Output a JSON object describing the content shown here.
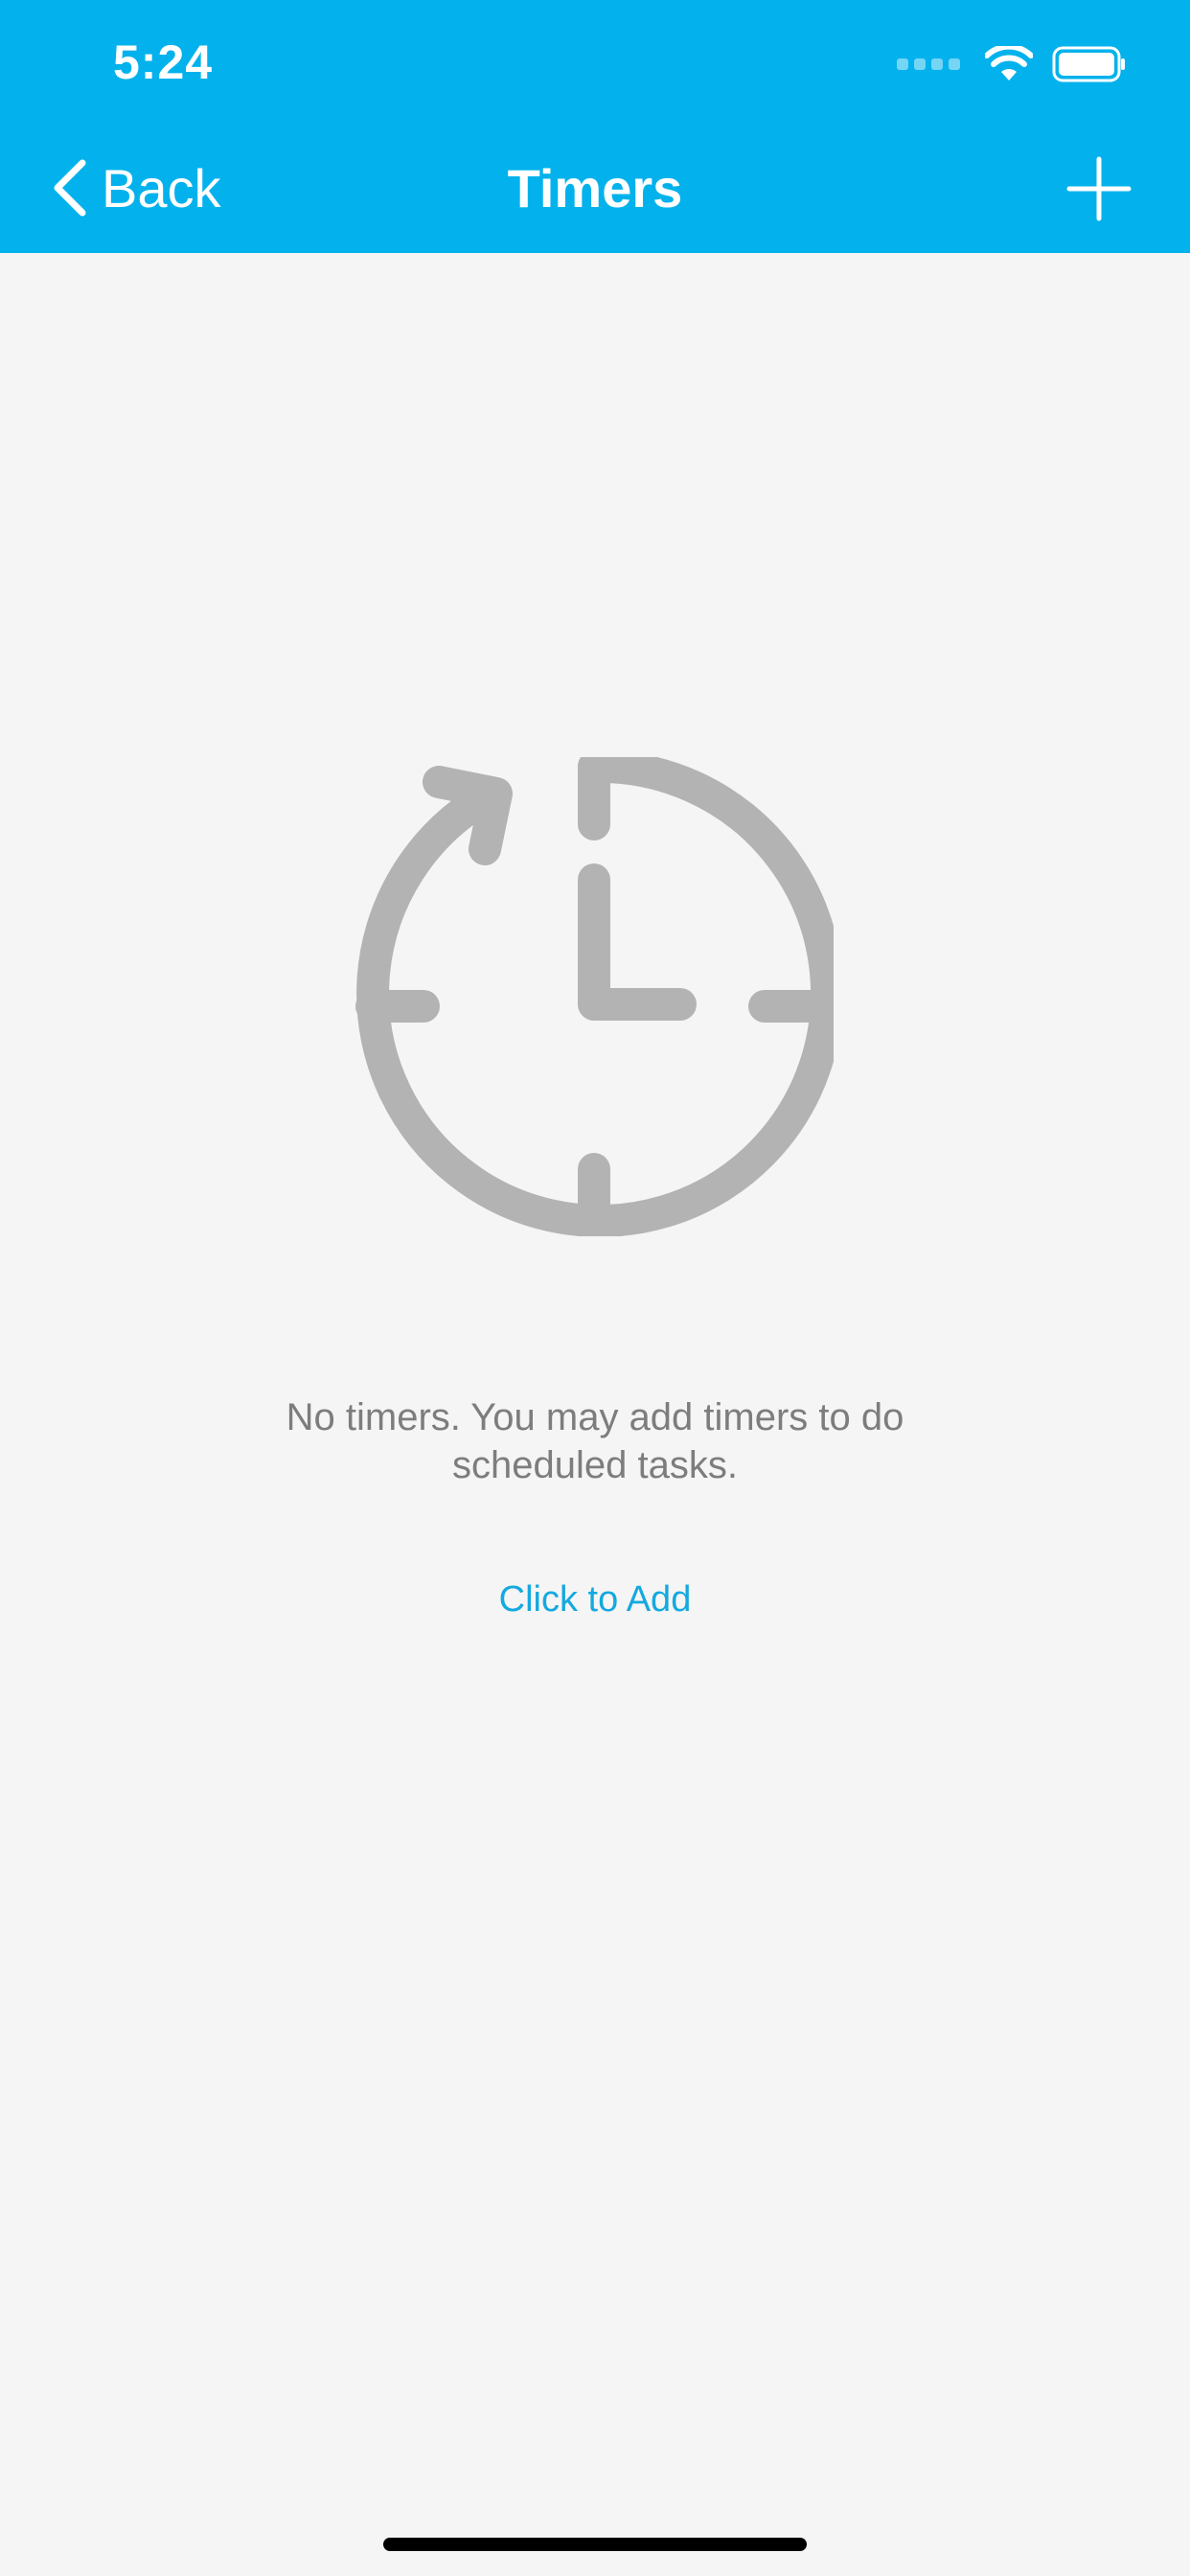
{
  "status_bar": {
    "time": "5:24"
  },
  "nav": {
    "back_label": "Back",
    "title": "Timers",
    "add_icon": "plus-icon",
    "back_icon": "chevron-left-icon"
  },
  "empty_state": {
    "icon": "timer-clock-icon",
    "message": "No timers. You may add timers to do scheduled tasks.",
    "action_label": "Click to Add"
  },
  "colors": {
    "header_bg": "#03b2ec",
    "page_bg": "#f5f5f5",
    "icon_gray": "#b3b3b3",
    "text_gray": "#7d7d7d",
    "link_blue": "#14a9df"
  }
}
